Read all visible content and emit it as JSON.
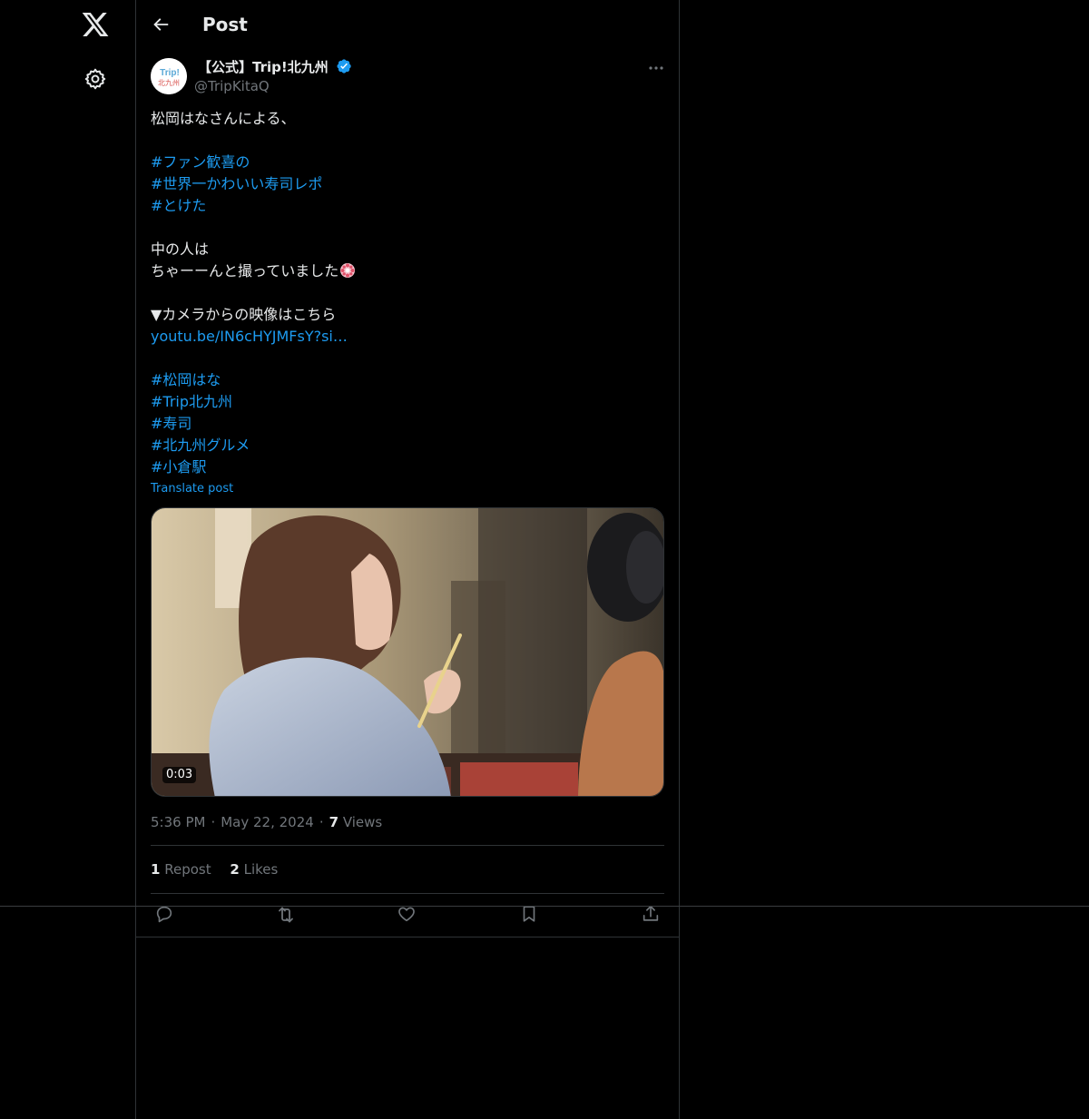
{
  "nav": {
    "logo_icon": "x-logo-icon",
    "settings_icon": "gear-icon"
  },
  "header": {
    "title": "Post",
    "back_icon": "arrow-left-icon"
  },
  "post": {
    "author": {
      "name": "【公式】Trip!北九州",
      "handle": "@TripKitaQ",
      "verified": true,
      "avatar_text_top": "Trip!",
      "avatar_text_bottom": "北九州"
    },
    "lines": [
      {
        "text": "松岡はなさんによる、",
        "type": "text"
      },
      {
        "text": "",
        "type": "text"
      },
      {
        "text": "#ファン歓喜の",
        "type": "link"
      },
      {
        "text": "#世界一かわいい寿司レポ",
        "type": "link"
      },
      {
        "text": "#とけた",
        "type": "link"
      },
      {
        "text": "",
        "type": "text"
      },
      {
        "text": "中の人は",
        "type": "text"
      },
      {
        "text": "ちゃーーんと撮っていました",
        "type": "text",
        "emoji": "flower-emoji"
      },
      {
        "text": "",
        "type": "text"
      },
      {
        "text": "▼カメラからの映像はこちら",
        "type": "text"
      },
      {
        "text": "youtu.be/IN6cHYJMFsY?si…",
        "type": "link"
      },
      {
        "text": "",
        "type": "text"
      },
      {
        "text": "#松岡はな",
        "type": "link"
      },
      {
        "text": "#Trip北九州",
        "type": "link"
      },
      {
        "text": "#寿司",
        "type": "link"
      },
      {
        "text": "#北九州グルメ",
        "type": "link"
      },
      {
        "text": "#小倉駅",
        "type": "link"
      }
    ],
    "translate_label": "Translate post",
    "media": {
      "type": "video",
      "duration": "0:03"
    },
    "time": "5:36 PM",
    "date": "May 22, 2024",
    "views_count": "7",
    "views_label": "Views",
    "reposts_count": "1",
    "reposts_label": "Repost",
    "likes_count": "2",
    "likes_label": "Likes"
  },
  "actions": [
    {
      "name": "reply",
      "icon": "reply-icon"
    },
    {
      "name": "repost",
      "icon": "repost-icon"
    },
    {
      "name": "like",
      "icon": "heart-icon"
    },
    {
      "name": "bookmark",
      "icon": "bookmark-icon"
    },
    {
      "name": "share",
      "icon": "share-icon"
    }
  ],
  "colors": {
    "background": "#000000",
    "text": "#e7e9ea",
    "muted": "#71767b",
    "link": "#1d9bf0",
    "border": "#2f3336",
    "verified": "#1d9bf0"
  }
}
